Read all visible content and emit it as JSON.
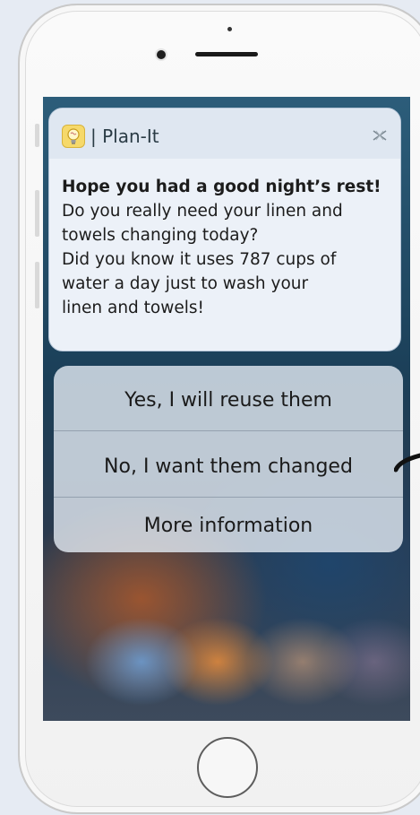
{
  "notification": {
    "app_name": "| Plan-It",
    "app_icon": "lightbulb-brain-icon",
    "close_icon": "close-icon",
    "title": "Hope you had a good night’s rest!",
    "lines": [
      "Do you really need your linen and",
      "towels changing today?",
      "Did you know it uses 787 cups of",
      "water a day just to wash your",
      "linen and towels!"
    ]
  },
  "actions": {
    "reuse_label": "Yes, I will reuse them",
    "change_label": "No, I want them changed",
    "info_label": "More information"
  },
  "colors": {
    "app_icon": "#f6d96a",
    "card": "#ecf1f8",
    "pointer": "#111111"
  }
}
